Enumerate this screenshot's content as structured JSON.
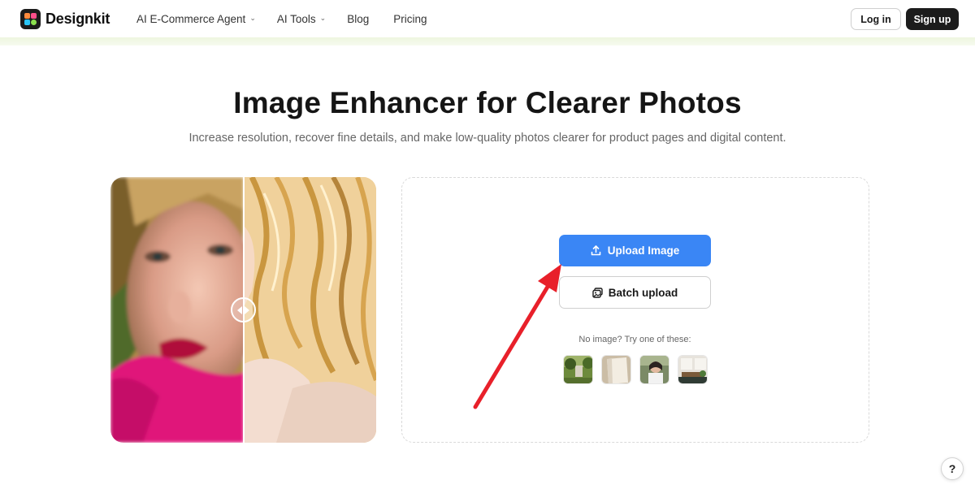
{
  "brand": {
    "name": "Designkit",
    "logo_colors": [
      "#ff8a3d",
      "#ff4f8b",
      "#29c5f6",
      "#8be04e"
    ]
  },
  "nav": {
    "items": [
      {
        "label": "AI E-Commerce Agent",
        "has_dropdown": true
      },
      {
        "label": "AI Tools",
        "has_dropdown": true
      },
      {
        "label": "Blog",
        "has_dropdown": false
      },
      {
        "label": "Pricing",
        "has_dropdown": false
      }
    ],
    "login_label": "Log in",
    "signup_label": "Sign up"
  },
  "hero": {
    "title": "Image Enhancer for Clearer Photos",
    "subtitle": "Increase resolution, recover fine details, and make low-quality photos clearer for product pages and digital content."
  },
  "upload": {
    "upload_button_label": "Upload Image",
    "batch_button_label": "Batch upload",
    "try_label": "No image? Try one of these:",
    "samples": [
      "garden-sample",
      "paper-sample",
      "portrait-sample",
      "room-sample"
    ]
  },
  "colors": {
    "accent": "#3a86f5",
    "dark": "#1c1c1c",
    "annotation_arrow": "#e8202a"
  },
  "help": {
    "label": "?"
  }
}
